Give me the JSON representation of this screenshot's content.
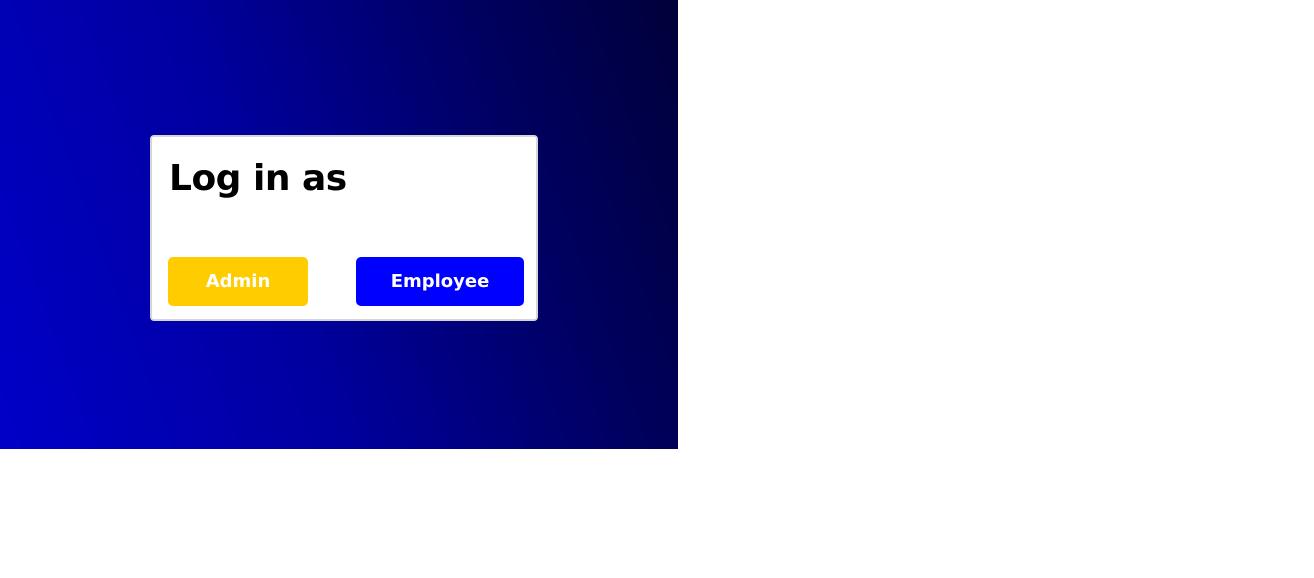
{
  "login": {
    "title": "Log in as",
    "admin_label": "Admin",
    "employee_label": "Employee"
  },
  "colors": {
    "admin_button": "#ffcc00",
    "employee_button": "#0000ff",
    "hero_gradient_start": "#0000c8",
    "hero_gradient_end": "#00003a"
  }
}
